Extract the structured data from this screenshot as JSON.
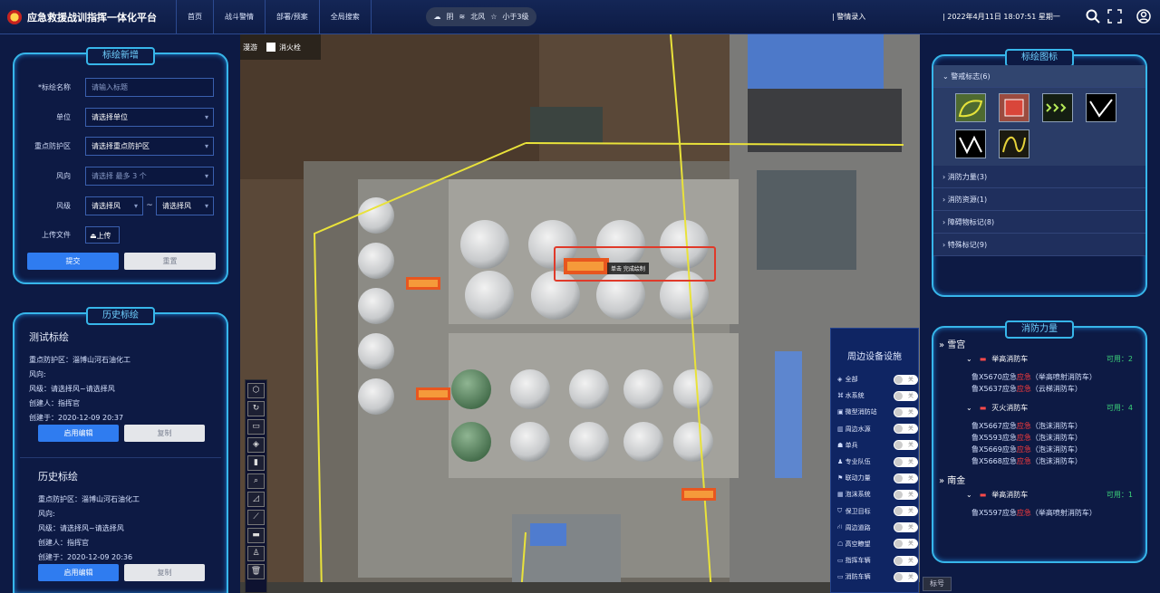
{
  "app": {
    "title": "应急救援战训指挥一体化平台"
  },
  "nav": [
    "首页",
    "战斗警情",
    "部署/预案",
    "全局搜索"
  ],
  "weather": {
    "condition": "阴",
    "wind_dir": "北风",
    "wind_level": "小于3级"
  },
  "alarm_entry": "警情录入",
  "datetime": "2022年4月11日 18:07:51 星期一",
  "icons": {
    "search": "search-icon",
    "fullscreen": "fullscreen-icon",
    "user": "user-icon"
  },
  "new_mark": {
    "title": "标绘新增",
    "name_label": "*标绘名称",
    "name_placeholder": "请输入标题",
    "unit_label": "单位",
    "unit_value": "请选择单位",
    "zone_label": "重点防护区",
    "zone_value": "请选择重点防护区",
    "wind_dir_label": "风向",
    "wind_dir_value": "请选择 最多 3 个",
    "wind_level_label": "风级",
    "wind_from": "请选择风",
    "range_sep": "~",
    "wind_to": "请选择风",
    "upload_label": "上传文件",
    "upload_button": "上传",
    "submit": "提交",
    "reset": "重置"
  },
  "history": {
    "title": "历史标绘",
    "records": [
      {
        "title": "测试标绘",
        "zone": "重点防护区：淄博山河石油化工",
        "wind_dir": "风向:",
        "wind_level": "风级：请选择风~请选择风",
        "creator": "创建人：指挥官",
        "created": "创建于：2020-12-09 20:37",
        "edit": "启用编辑",
        "copy": "复制"
      },
      {
        "title": "历史标绘",
        "zone": "重点防护区：淄博山河石油化工",
        "wind_dir": "风向:",
        "wind_level": "风级：请选择风~请选择风",
        "creator": "创建人：指挥官",
        "created": "创建于：2020-12-09 20:36",
        "edit": "启用编辑",
        "copy": "复制"
      }
    ]
  },
  "map": {
    "layer_toggle_a": "漫游",
    "layer_toggle_b": "消火栓",
    "tooltip": "单击 完成绘制"
  },
  "tools": [
    "cube-icon",
    "rotate-icon",
    "ruler-icon",
    "box-icon",
    "bar-icon",
    "magnify-icon",
    "angle-icon",
    "line-icon",
    "truck-icon",
    "person-icon",
    "trash-icon"
  ],
  "facilities": {
    "title": "周边设备设施",
    "off": "关",
    "items": [
      {
        "name": "全部",
        "icon": "layers-icon"
      },
      {
        "name": "水系统",
        "icon": "water-icon"
      },
      {
        "name": "微型消防站",
        "icon": "station-icon"
      },
      {
        "name": "周边水源",
        "icon": "source-icon"
      },
      {
        "name": "单兵",
        "icon": "soldier-icon"
      },
      {
        "name": "专业队伍",
        "icon": "team-icon"
      },
      {
        "name": "联动力量",
        "icon": "linkage-icon"
      },
      {
        "name": "泡沫系统",
        "icon": "foam-icon"
      },
      {
        "name": "保卫目标",
        "icon": "shield-icon"
      },
      {
        "name": "周边道路",
        "icon": "road-icon"
      },
      {
        "name": "高空瞭望",
        "icon": "tower-icon"
      },
      {
        "name": "指挥车辆",
        "icon": "command-car-icon"
      },
      {
        "name": "消防车辆",
        "icon": "fire-car-icon"
      }
    ]
  },
  "mark_icons": {
    "title": "标绘图标",
    "sections": [
      {
        "label": "警戒标志(6)",
        "expanded": true
      },
      {
        "label": "消防力量(3)"
      },
      {
        "label": "消防资源(1)"
      },
      {
        "label": "障碍物标记(8)"
      },
      {
        "label": "特殊标记(9)"
      }
    ]
  },
  "fire_power": {
    "title": "消防力量",
    "stations": [
      {
        "name": "雪宫",
        "types": [
          {
            "type": "举高消防车",
            "avail": "可用：2",
            "vehicles": [
              {
                "plate": "鲁X5670应急",
                "tag": "应急",
                "model": "（举高喷射消防车）"
              },
              {
                "plate": "鲁X5637应急",
                "tag": "应急",
                "model": "（云梯消防车）"
              }
            ]
          },
          {
            "type": "灭火消防车",
            "avail": "可用：4",
            "vehicles": [
              {
                "plate": "鲁X5667应急",
                "tag": "应急",
                "model": "（泡沫消防车）"
              },
              {
                "plate": "鲁X5593应急",
                "tag": "应急",
                "model": "（泡沫消防车）"
              },
              {
                "plate": "鲁X5669应急",
                "tag": "应急",
                "model": "（泡沫消防车）"
              },
              {
                "plate": "鲁X5668应急",
                "tag": "应急",
                "model": "（泡沫消防车）"
              }
            ]
          }
        ]
      },
      {
        "name": "南金",
        "types": [
          {
            "type": "举高消防车",
            "avail": "可用：1",
            "vehicles": [
              {
                "plate": "鲁X5597应急",
                "tag": "应急",
                "model": "（举高喷射消防车）"
              }
            ]
          }
        ]
      }
    ]
  },
  "bottom_tab": "标号"
}
